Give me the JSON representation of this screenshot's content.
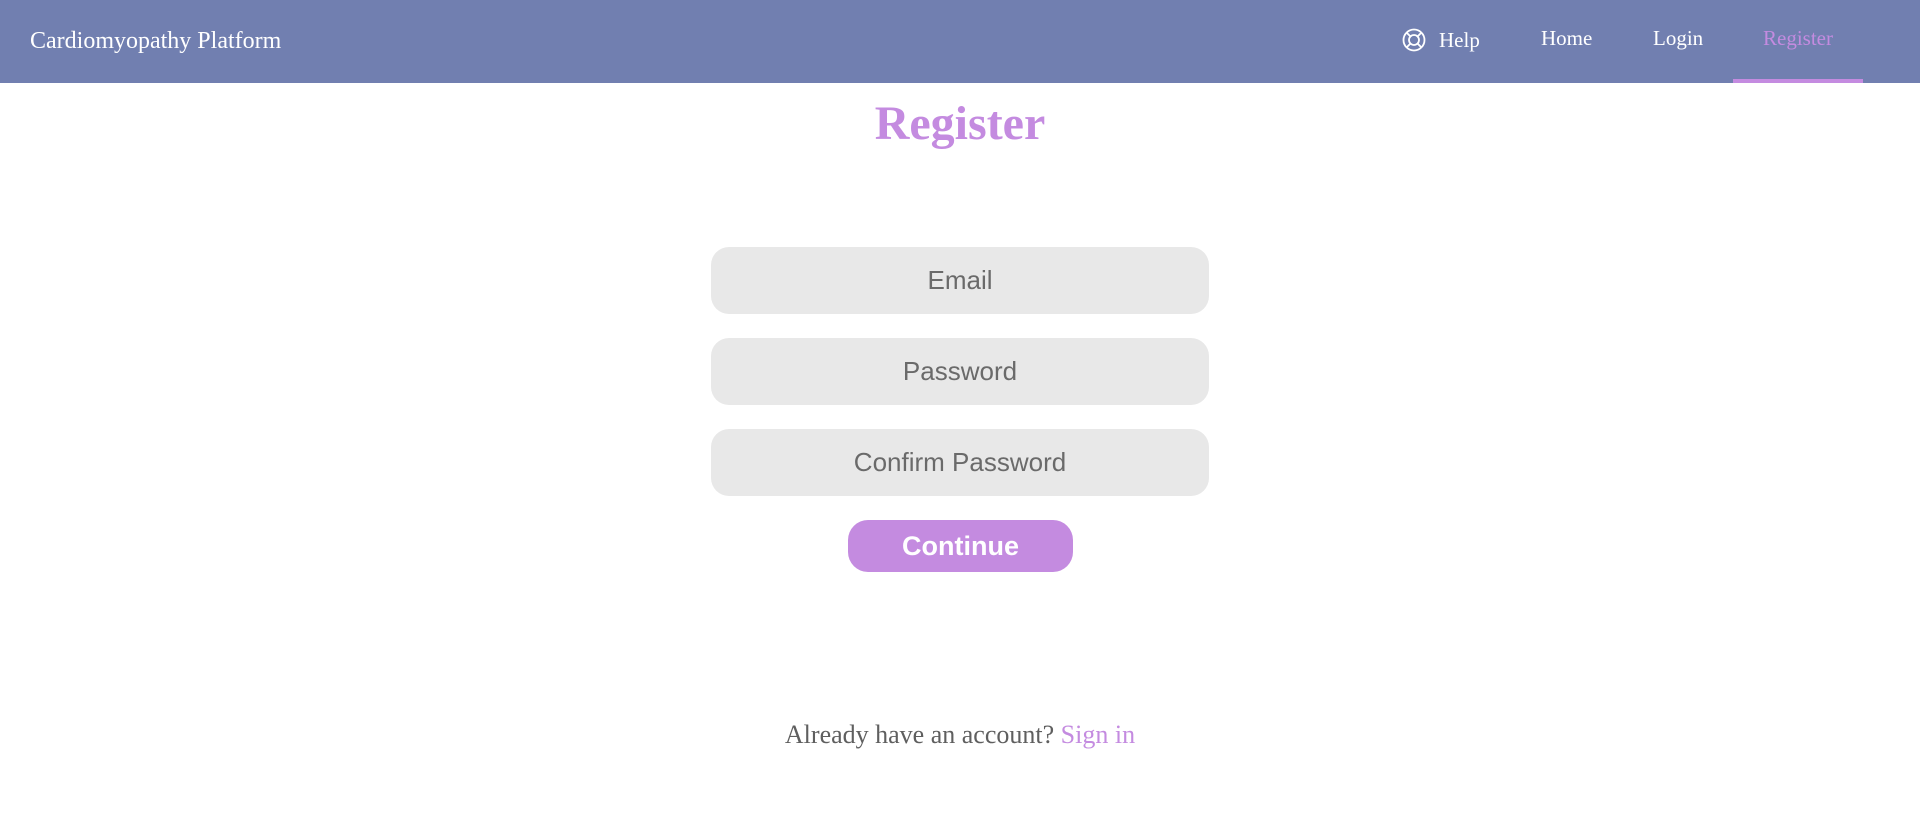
{
  "navbar": {
    "brand": "Cardiomyopathy Platform",
    "help_label": "Help",
    "help_icon": "lifebuoy-icon",
    "home_label": "Home",
    "login_label": "Login",
    "register_label": "Register",
    "active_item": "Register",
    "background_color": "#717fb0",
    "accent_color": "#c48be0"
  },
  "form": {
    "title": "Register",
    "email_placeholder": "Email",
    "password_placeholder": "Password",
    "confirm_password_placeholder": "Confirm Password",
    "continue_label": "Continue"
  },
  "footer": {
    "prompt_text": "Already have an account?",
    "signin_label": "Sign in"
  }
}
